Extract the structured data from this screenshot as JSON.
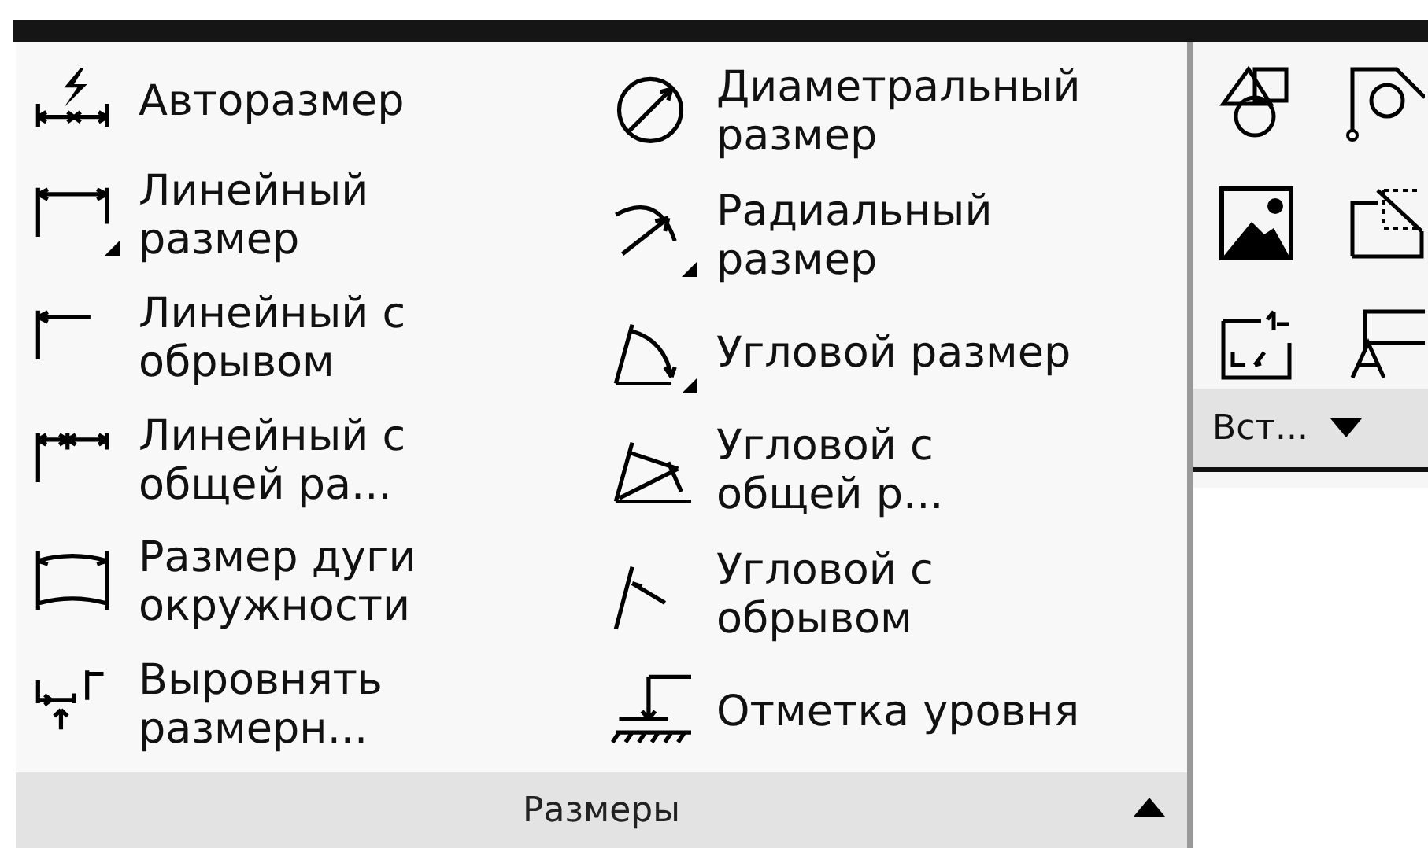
{
  "dimensions_panel": {
    "columns": [
      {
        "items": [
          {
            "label": "Авторазмер",
            "has_menu": false
          },
          {
            "label": "Линейный размер",
            "has_menu": true
          },
          {
            "label": "Линейный с обрывом",
            "has_menu": false
          },
          {
            "label": "Линейный с общей ра...",
            "has_menu": false
          },
          {
            "label": "Размер дуги окружности",
            "has_menu": false
          },
          {
            "label": "Выровнять размерн...",
            "has_menu": false
          }
        ]
      },
      {
        "items": [
          {
            "label": "Диаметральный размер",
            "has_menu": false
          },
          {
            "label": "Радиальный размер",
            "has_menu": true
          },
          {
            "label": "Угловой размер",
            "has_menu": true
          },
          {
            "label": "Угловой с общей р...",
            "has_menu": false
          },
          {
            "label": "Угловой с обрывом",
            "has_menu": false
          },
          {
            "label": "Отметка уровня",
            "has_menu": false
          }
        ]
      }
    ],
    "title": "Размеры",
    "expanded": true
  },
  "insert_panel": {
    "title": "Вст...",
    "expanded": false
  }
}
